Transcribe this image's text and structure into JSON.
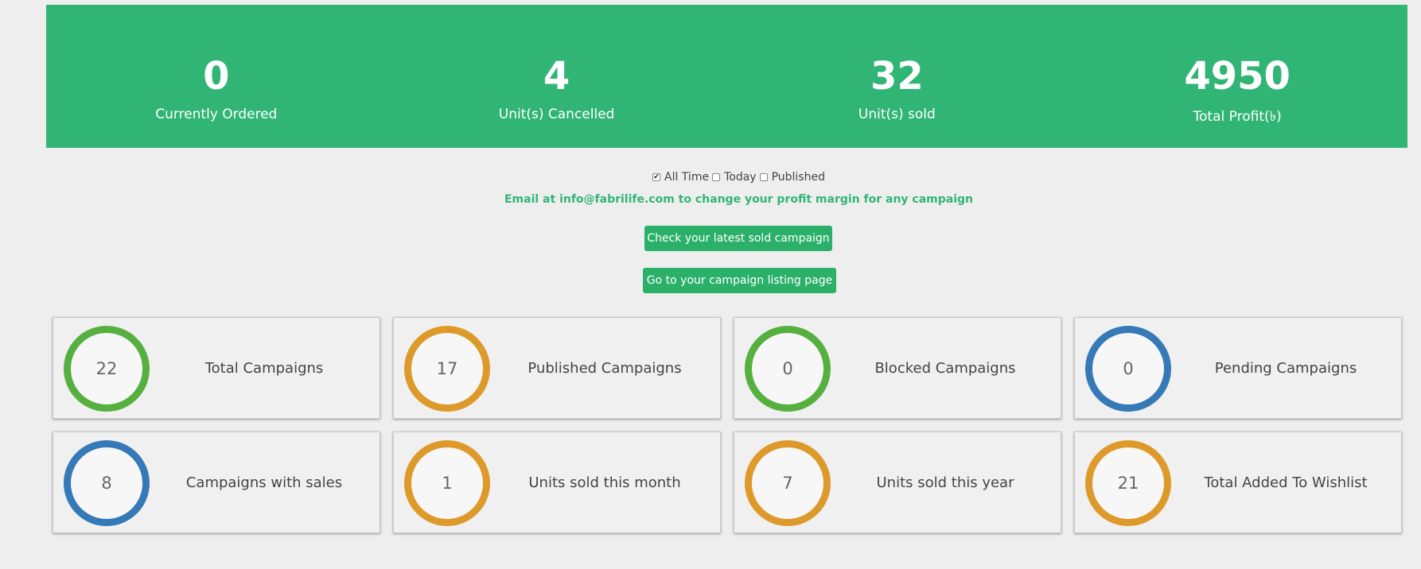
{
  "stats": [
    {
      "value": "0",
      "label": "Currently Ordered"
    },
    {
      "value": "4",
      "label": "Unit(s) Cancelled"
    },
    {
      "value": "32",
      "label": "Unit(s) sold"
    },
    {
      "value": "4950",
      "label": "Total Profit(৳)"
    }
  ],
  "filters": [
    {
      "label": "All Time",
      "checked": true
    },
    {
      "label": "Today",
      "checked": false
    },
    {
      "label": "Published",
      "checked": false
    }
  ],
  "notice": "Email at info@fabrilife.com to change your profit margin for any campaign",
  "buttons": {
    "latest": "Check your latest sold campaign",
    "listing": "Go to your campaign listing page"
  },
  "colors": {
    "banner": "#31b575",
    "green": "#55b040",
    "orange": "#dd9a2b",
    "blue": "#3579b7"
  },
  "cards": [
    {
      "value": "22",
      "label": "Total Campaigns",
      "color": "#55b040"
    },
    {
      "value": "17",
      "label": "Published Campaigns",
      "color": "#dd9a2b"
    },
    {
      "value": "0",
      "label": "Blocked Campaigns",
      "color": "#55b040"
    },
    {
      "value": "0",
      "label": "Pending Campaigns",
      "color": "#3579b7"
    },
    {
      "value": "8",
      "label": "Campaigns with sales",
      "color": "#3579b7"
    },
    {
      "value": "1",
      "label": "Units sold this month",
      "color": "#dd9a2b"
    },
    {
      "value": "7",
      "label": "Units sold this year",
      "color": "#dd9a2b"
    },
    {
      "value": "21",
      "label": "Total Added To Wishlist",
      "color": "#dd9a2b"
    }
  ]
}
